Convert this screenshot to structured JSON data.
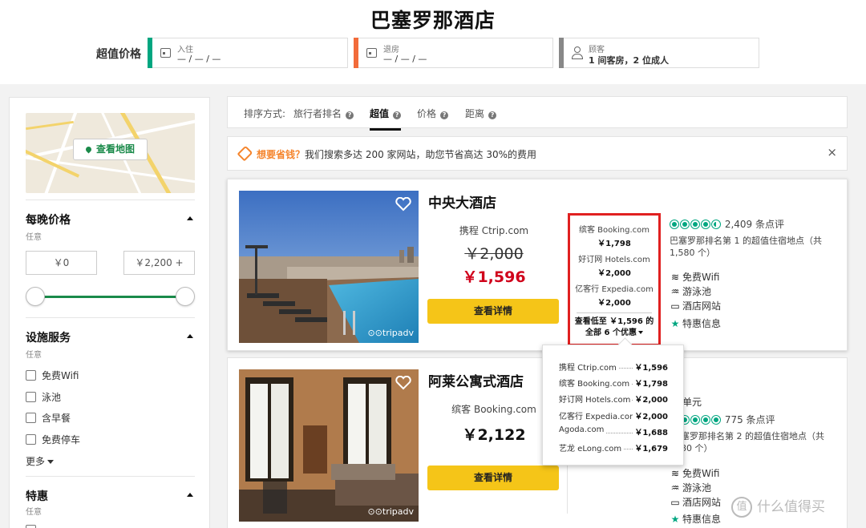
{
  "header": {
    "title": "巴塞罗那酒店",
    "deal_label": "超值价格",
    "checkin": {
      "label": "入住",
      "value": "— / — / —"
    },
    "checkout": {
      "label": "退房",
      "value": "— / — / —"
    },
    "guests": {
      "label": "顾客",
      "value": "1 间客房，2 位成人"
    },
    "colors": {
      "checkin": "#00a680",
      "checkout": "#f26b3a",
      "guests": "#888888"
    }
  },
  "sidebar": {
    "map_button": "查看地图",
    "price": {
      "title": "每晚价格",
      "sub": "任意",
      "min": "￥0",
      "max": "￥2,200 +"
    },
    "amenities": {
      "title": "设施服务",
      "sub": "任意",
      "options": [
        "免费Wifi",
        "泳池",
        "含早餐",
        "免费停车"
      ],
      "more": "更多"
    },
    "deals": {
      "title": "特惠",
      "sub": "任意"
    }
  },
  "sort": {
    "label": "排序方式:",
    "options": [
      {
        "label": "旅行者排名",
        "active": false
      },
      {
        "label": "超值",
        "active": true
      },
      {
        "label": "价格",
        "active": false
      },
      {
        "label": "距离",
        "active": false
      }
    ]
  },
  "promo": {
    "highlight": "想要省钱？",
    "message": "我们搜索多达 200 家网站，助您节省高达 30%的费用",
    "close": "×"
  },
  "hotels": [
    {
      "name": "中央大酒店",
      "provider": "携程 Ctrip.com",
      "old_price": "￥2,000",
      "price": "￥1,596",
      "button": "查看详情",
      "watermark": "tripadv",
      "other_offers": [
        {
          "name": "缤客 Booking.com",
          "price": "￥1,798"
        },
        {
          "name": "好订网 Hotels.com",
          "price": "￥2,000"
        },
        {
          "name": "亿客行 Expedia.com",
          "price": "￥2,000"
        }
      ],
      "see_all_line1": "查看低至 ￥1,596 的",
      "see_all_line2": "全部 6 个优惠",
      "rating_bubbles": 4.5,
      "reviews": "2,409 条点评",
      "rank": "巴塞罗那排名第 1 的超值住宿地点（共 1,580 个）",
      "amenities": [
        "免费Wifi",
        "游泳池",
        "酒店网站",
        "特惠信息"
      ]
    },
    {
      "name": "阿莱公寓式酒店",
      "provider": "缤客 Booking.com",
      "price": "￥2,122",
      "button": "查看详情",
      "watermark": "tripadv",
      "partial_text": "单元",
      "rating_bubbles": 5,
      "reviews": "775 条点评",
      "rank": "塞罗那排名第 2 的超值住宿地点（共",
      "rank_line2": "80 个）",
      "amenities": [
        "免费Wifi",
        "游泳池",
        "酒店网站",
        "特惠信息"
      ]
    }
  ],
  "popup": {
    "offers": [
      {
        "name": "携程 Ctrip.com",
        "price": "￥1,596"
      },
      {
        "name": "缤客 Booking.com",
        "price": "￥1,798"
      },
      {
        "name": "好订网 Hotels.com",
        "price": "￥2,000"
      },
      {
        "name": "亿客行 Expedia.com",
        "price": "￥2,000"
      },
      {
        "name": "Agoda.com",
        "price": "￥1,688"
      },
      {
        "name": "艺龙 eLong.com",
        "price": "￥1,679"
      }
    ]
  },
  "brand_watermark": "什么值得买",
  "brand_glyph": "值",
  "colors": {
    "accent_green": "#00a680",
    "button_yellow": "#f5c518",
    "price_red": "#d0021b",
    "highlight_box": "#e02020",
    "promo_orange": "#f5852d"
  }
}
